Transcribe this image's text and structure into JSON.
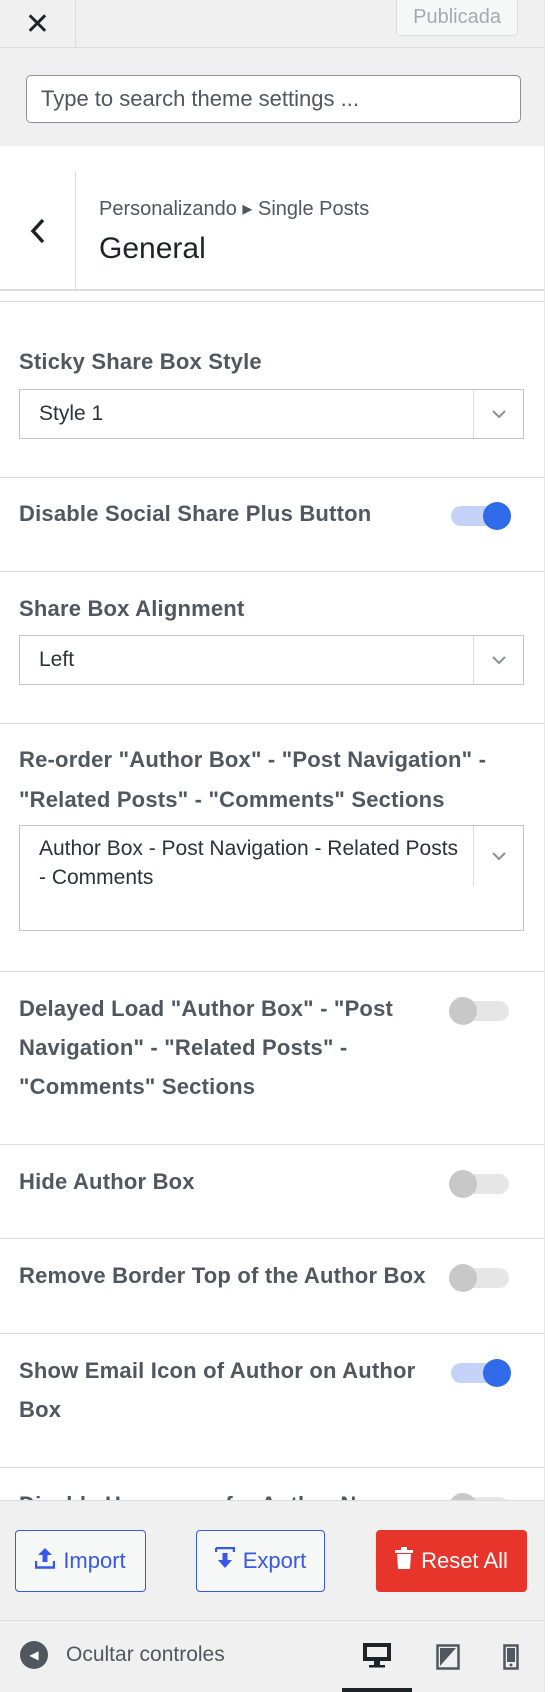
{
  "topbar": {
    "close_icon": "close-icon",
    "close_glyph": "✕",
    "publish_label": "Publicada"
  },
  "search": {
    "placeholder": "Type to search theme settings ..."
  },
  "panel": {
    "back_glyph": "‹",
    "breadcrumb": "Personalizando ▸ Single Posts",
    "title": "General"
  },
  "settings": {
    "sticky_share_box_style": {
      "label": "Sticky Share Box Style",
      "value": "Style 1"
    },
    "disable_social_share_plus": {
      "label": "Disable Social Share Plus Button",
      "on": true
    },
    "share_box_alignment": {
      "label": "Share Box Alignment",
      "value": "Left"
    },
    "reorder_sections": {
      "label_line1": "Re-order \"Author Box\" - \"Post Navigation\" -",
      "label_line2": "\"Related Posts\" - \"Comments\" Sections",
      "value": "Author Box - Post Navigation - Related Posts - Comments"
    },
    "delayed_load": {
      "label_line1": "Delayed Load \"Author Box\" - \"Post",
      "label_line2": "Navigation\" - \"Related Posts\" -",
      "label_line3": "\"Comments\" Sections",
      "on": false
    },
    "hide_author_box": {
      "label": "Hide Author Box",
      "on": false
    },
    "remove_border_top": {
      "label": "Remove Border Top of the Author Box",
      "on": false
    },
    "show_email_icon": {
      "label_line1": "Show Email Icon of Author on Author",
      "label_line2": "Box",
      "on": true
    },
    "partial_item": {
      "label": "Disable Homepage for Author Name",
      "on": false
    }
  },
  "footer": {
    "import_label": "Import",
    "export_label": "Export",
    "reset_label": "Reset All"
  },
  "bottombar": {
    "hide_controls_label": "Ocultar controles",
    "devices": [
      "desktop",
      "tablet",
      "mobile"
    ],
    "active_device": "desktop"
  },
  "colors": {
    "accent": "#3858e9",
    "toggle_on": "#2f6ae9",
    "reset": "#e8352b"
  }
}
